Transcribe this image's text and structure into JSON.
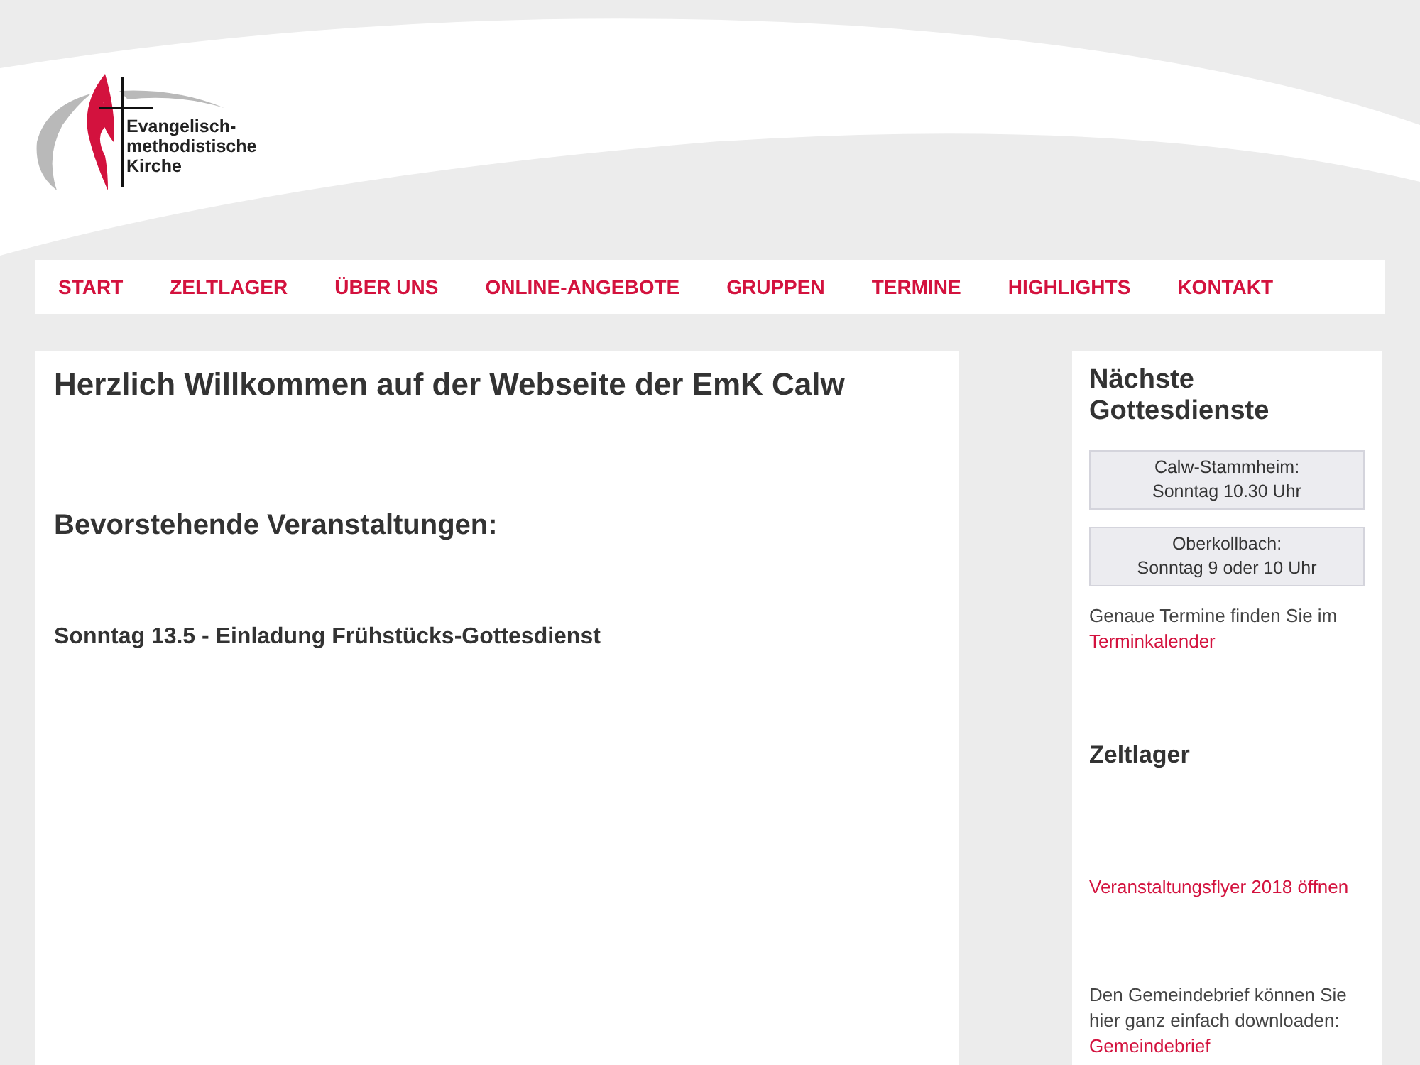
{
  "logo": {
    "lines": [
      "Evangelisch-",
      "methodistische",
      "Kirche"
    ]
  },
  "nav": [
    "START",
    "ZELTLAGER",
    "ÜBER UNS",
    "ONLINE-ANGEBOTE",
    "GRUPPEN",
    "TERMINE",
    "HIGHLIGHTS",
    "KONTAKT"
  ],
  "main": {
    "title": "Herzlich Willkommen auf der Webseite der EmK Calw",
    "section_heading": "Bevorstehende Veranstaltungen:",
    "event": "Sonntag 13.5 - Einladung Frühstücks-Gottesdienst"
  },
  "sidebar": {
    "heading": "Nächste Gottesdienste",
    "services": [
      {
        "place": "Calw-Stammheim:",
        "time": "Sonntag 10.30 Uhr"
      },
      {
        "place": "Oberkollbach:",
        "time": "Sonntag 9 oder 10 Uhr"
      }
    ],
    "calendar_note": {
      "text": "Genaue Termine finden Sie im",
      "link": "Terminkalender"
    },
    "zeltlager_heading": "Zeltlager",
    "flyer_link": "Veranstaltungsflyer 2018 öffnen",
    "newsletter_note": {
      "text": "Den Gemeindebrief können Sie hier ganz einfach downloaden:",
      "link": "Gemeindebrief"
    }
  }
}
